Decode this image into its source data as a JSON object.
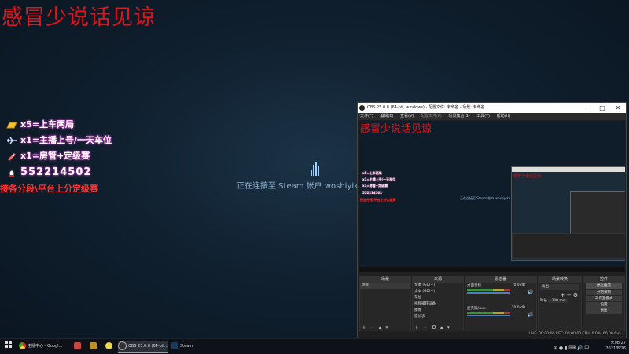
{
  "stream": {
    "headline": "感冒少说话见谅",
    "rules": [
      {
        "icon": "gold-bar-icon",
        "text": "x5=上车两局"
      },
      {
        "icon": "plane-icon",
        "text": "x1=主播上号/一天车位"
      },
      {
        "icon": "rocket-icon",
        "text": "x1=房管+定级赛"
      }
    ],
    "qq_number": "552214502",
    "qq_icon": "qq-penguin-icon",
    "note": "接各分段\\平台上分定级赛",
    "steam_status": "正在连接至 Steam 帐户 woshiyike",
    "colors": {
      "headline": "#e0141c",
      "note": "#ff3030",
      "glow": "#ff3da6"
    }
  },
  "obs": {
    "title": "OBS 25.0.8 (64-bit, windows) - 配置文件: 未命名 - 场景: 未命名",
    "menu": [
      "文件(F)",
      "编辑(E)",
      "查看(V)",
      "配置文件(P)",
      "场景集合(S)",
      "工具(T)",
      "帮助(H)"
    ],
    "preview_headline": "感冒少说话见谅",
    "docks": {
      "scenes": {
        "title": "场景",
        "items": [
          "场景"
        ]
      },
      "sources": {
        "title": "来源",
        "items": [
          "文本 (GDI+)",
          "文本 (GDI+)",
          "车位",
          "视频捕获设备",
          "图像",
          "定价表"
        ]
      },
      "mixer": {
        "title": "混音器",
        "channels": [
          {
            "name": "桌面音频",
            "db": "0.0 dB"
          },
          {
            "name": "麦克风/Aux",
            "db": "10.0 dB"
          }
        ]
      },
      "transitions": {
        "title": "场景转换",
        "type": "淡出",
        "duration_label": "时长",
        "duration": "300 ms"
      },
      "controls": {
        "title": "控件",
        "buttons": [
          "停止推流",
          "开始录制",
          "工作室模式",
          "设置",
          "退出"
        ]
      }
    },
    "status": "LIVE: 00:00:00   REC: 00:00:00   CPU: 0.0%, 60.00 fps"
  },
  "taskbar": {
    "items": [
      {
        "label": "主播中心 - Googl...",
        "icon": "chrome-icon"
      },
      {
        "label": "",
        "icon": "app-icon-1"
      },
      {
        "label": "",
        "icon": "app-icon-2"
      },
      {
        "label": "",
        "icon": "app-icon-3"
      },
      {
        "label": "OBS 25.0.8 (64-bit...",
        "icon": "obs-icon"
      },
      {
        "label": "Steam",
        "icon": "steam-icon"
      }
    ],
    "time": "9:08:27",
    "date": "2021/8/26"
  }
}
